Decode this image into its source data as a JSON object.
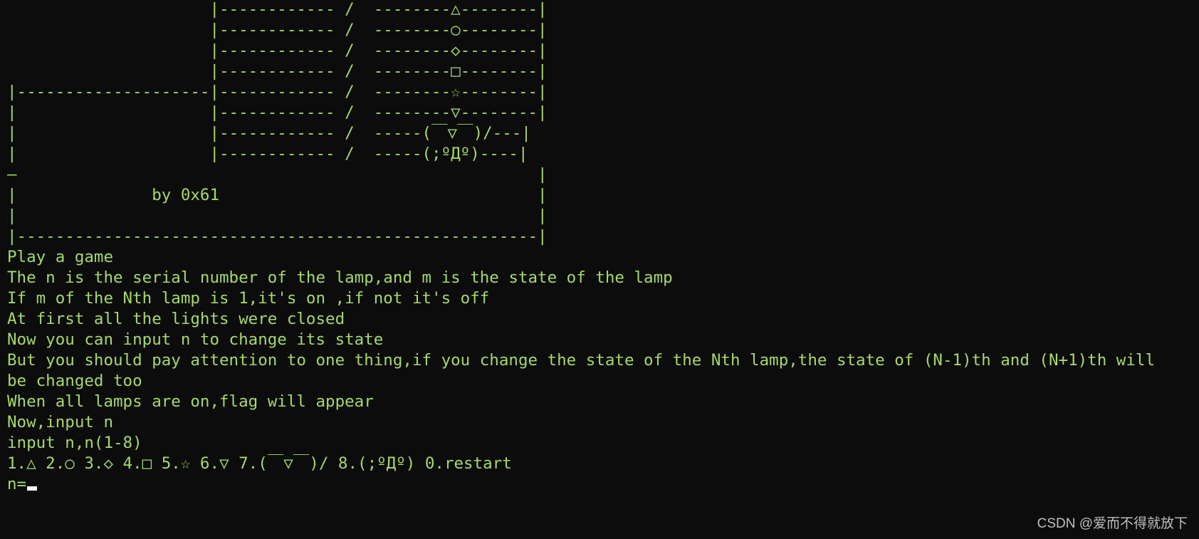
{
  "terminal": {
    "lines": [
      "                     |------------ /  --------△--------|",
      "                     |------------ /  --------○--------|",
      "                     |------------ /  --------◇--------|",
      "                     |------------ /  --------□--------|",
      "|--------------------|------------ /  --------☆--------|",
      "|                    |------------ /  --------▽--------|",
      "|                    |------------ /  -----(￣▽￣)/---|",
      "|                    |------------ /  -----(;ºДº)----|",
      "—                                                      |",
      "|              by 0x61                                 |",
      "|                                                      |",
      "|------------------------------------------------------|",
      "Play a game",
      "The n is the serial number of the lamp,and m is the state of the lamp",
      "If m of the Nth lamp is 1,it's on ,if not it's off",
      "At first all the lights were closed",
      "Now you can input n to change its state",
      "But you should pay attention to one thing,if you change the state of the Nth lamp,the state of (N-1)th and (N+1)th will",
      "be changed too",
      "When all lamps are on,flag will appear",
      "Now,input n",
      "input n,n(1-8)",
      "1.△ 2.○ 3.◇ 4.□ 5.☆ 6.▽ 7.(￣▽￣)/ 8.(;ºДº) 0.restart"
    ],
    "prompt": "n=",
    "input_value": "",
    "text_color": "#a6d96b",
    "background_color": "#0c0c0c",
    "cursor_color": "#f2f2f2"
  },
  "watermark": {
    "text": "CSDN @爱而不得就放下"
  }
}
